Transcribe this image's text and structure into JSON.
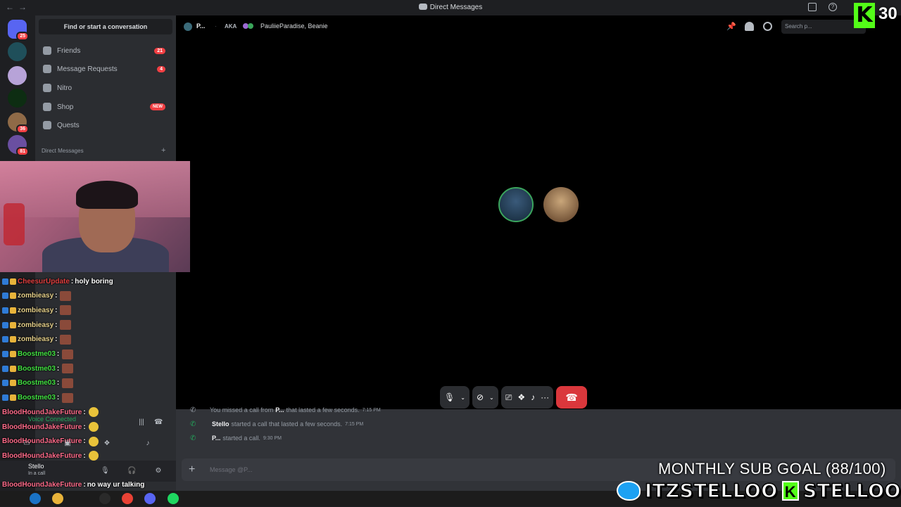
{
  "window": {
    "title": "Direct Messages"
  },
  "guilds": [
    {
      "color": "#5865f2",
      "badge": "25"
    },
    {
      "color": "#1f4f5a",
      "badge": ""
    },
    {
      "color": "#b7a3d8",
      "badge": ""
    },
    {
      "color": "#0d2d12",
      "badge": ""
    },
    {
      "color": "#8f6a47",
      "badge": "36"
    },
    {
      "color": "#6a4fa1",
      "badge": "81"
    }
  ],
  "sidebar": {
    "search_label": "Find or start a conversation",
    "items": [
      {
        "label": "Friends",
        "count": "21"
      },
      {
        "label": "Message Requests",
        "count": "4"
      },
      {
        "label": "Nitro",
        "count": ""
      },
      {
        "label": "Shop",
        "tag": "NEW"
      },
      {
        "label": "Quests",
        "count": ""
      }
    ],
    "dm_header": "Direct Messages",
    "dm_plus": "+"
  },
  "chat": [
    {
      "user": "CheesurUpdate",
      "color": "#e03f3f",
      "text": "holy boring",
      "emote": ""
    },
    {
      "user": "zombieasy",
      "color": "#e6d08a",
      "text": "",
      "emote": "square"
    },
    {
      "user": "zombieasy",
      "color": "#e6d08a",
      "text": "",
      "emote": "square"
    },
    {
      "user": "zombieasy",
      "color": "#e6d08a",
      "text": "",
      "emote": "square"
    },
    {
      "user": "zombieasy",
      "color": "#e6d08a",
      "text": "",
      "emote": "square"
    },
    {
      "user": "Boostme03",
      "color": "#42e042",
      "text": "",
      "emote": "square"
    },
    {
      "user": "Boostme03",
      "color": "#42e042",
      "text": "",
      "emote": "square"
    },
    {
      "user": "Boostme03",
      "color": "#42e042",
      "text": "",
      "emote": "square"
    },
    {
      "user": "Boostme03",
      "color": "#42e042",
      "text": "",
      "emote": "square"
    },
    {
      "user": "BloodHoundJakeFuture",
      "color": "#ff6b8a",
      "text": "",
      "emote": "round"
    },
    {
      "user": "BloodHoundJakeFuture",
      "color": "#ff6b8a",
      "text": "",
      "emote": "round"
    },
    {
      "user": "BloodHoundJakeFuture",
      "color": "#ff6b8a",
      "text": "",
      "emote": "round"
    },
    {
      "user": "BloodHoundJakeFuture",
      "color": "#ff6b8a",
      "text": "",
      "emote": "round"
    },
    {
      "user": "zombieasy",
      "color": "#e6d08a",
      "text": "",
      "emote": "square"
    },
    {
      "user": "BloodHoundJakeFuture",
      "color": "#ff6b8a",
      "text": "no way ur talking",
      "emote": ""
    },
    {
      "user": "BloodHoundJakeFuture",
      "color": "#ff6b8a",
      "text": "..",
      "emote": ""
    }
  ],
  "voice": {
    "status": "Voice Connected"
  },
  "user": {
    "name": "Stello",
    "status": "In a call"
  },
  "header": {
    "name": "P...",
    "aka_label": "AKA",
    "aka_names": "PauliieParadise, Beanie",
    "search_placeholder": "Search p..."
  },
  "messages": [
    {
      "prefix": "You missed a call from",
      "user": "P...",
      "suffix": "that lasted a few seconds.",
      "time": "7:15 PM",
      "missed": true
    },
    {
      "prefix": "",
      "user": "Stello",
      "suffix": "started a call that lasted a few seconds.",
      "time": "7:15 PM",
      "missed": false
    },
    {
      "prefix": "",
      "user": "P...",
      "suffix": "started a call.",
      "time": "9:30 PM",
      "missed": false
    }
  ],
  "composer": {
    "placeholder": "Message @P..."
  },
  "overlay": {
    "k_letter": "K",
    "viewer_count": "30",
    "sub_goal": "MONTHLY SUB GOAL (88/100)",
    "twitter_handle": "ITZSTELLOO",
    "kick_handle": "STELLOOO"
  },
  "taskbar": {
    "apps": [
      {
        "name": "edge",
        "color": "#1a73c6"
      },
      {
        "name": "explorer",
        "color": "#e8b33a"
      },
      {
        "name": "obs",
        "color": "#2a2a2a"
      },
      {
        "name": "chrome",
        "color": "#e94235"
      },
      {
        "name": "discord",
        "color": "#5865f2"
      },
      {
        "name": "spotify",
        "color": "#1ed760"
      }
    ]
  }
}
